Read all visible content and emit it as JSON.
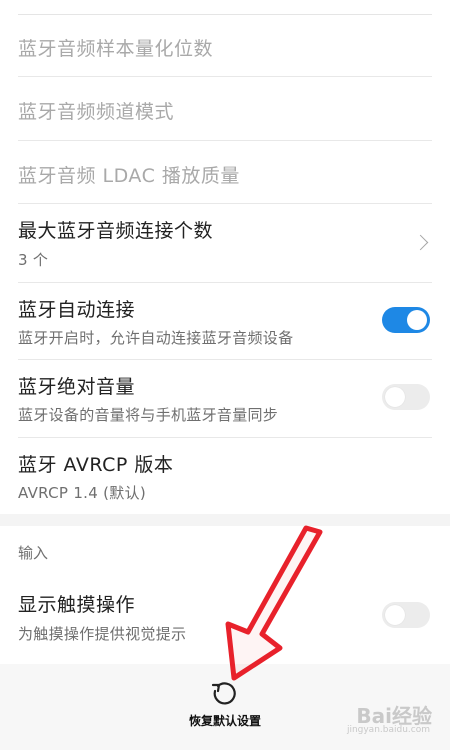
{
  "settings": [
    {
      "title": "蓝牙音频样本量化位数"
    },
    {
      "title": "蓝牙音频频道模式"
    },
    {
      "title": "蓝牙音频 LDAC 播放质量"
    },
    {
      "title": "最大蓝牙音频连接个数",
      "subtitle": "3 个"
    },
    {
      "title": "蓝牙自动连接",
      "subtitle": "蓝牙开启时，允许自动连接蓝牙音频设备",
      "toggle": true
    },
    {
      "title": "蓝牙绝对音量",
      "subtitle": "蓝牙设备的音量将与手机蓝牙音量同步",
      "toggle": false
    },
    {
      "title": "蓝牙 AVRCP 版本",
      "subtitle": "AVRCP 1.4 (默认)"
    }
  ],
  "input_section": {
    "header": "输入",
    "items": [
      {
        "title": "显示触摸操作",
        "subtitle": "为触摸操作提供视觉提示",
        "toggle": false
      }
    ]
  },
  "bottom_bar": {
    "reset_label": "恢复默认设置",
    "icon": "reset-icon"
  },
  "watermark": {
    "text": "Bai经验",
    "url_text": "jingyan.baidu.com"
  },
  "colors": {
    "accent": "#1e88e5",
    "annotation_arrow": "#e8212b"
  }
}
